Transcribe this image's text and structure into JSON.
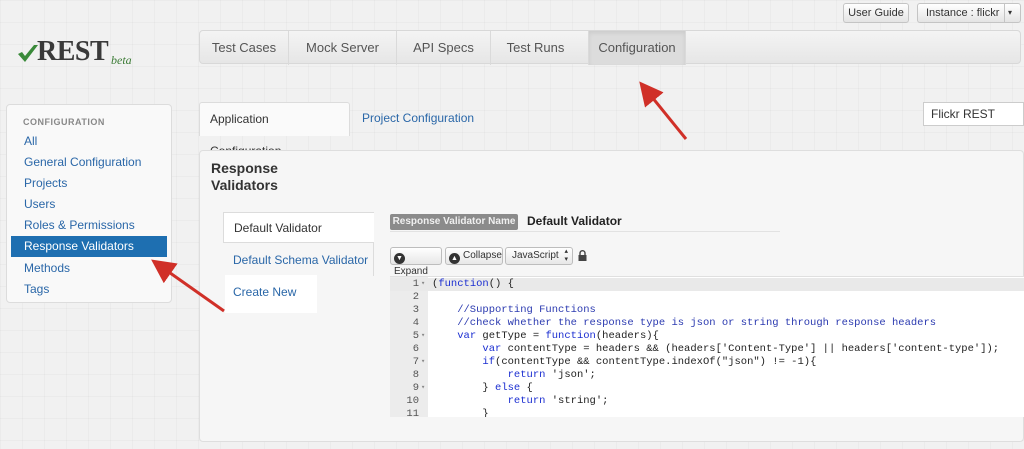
{
  "header": {
    "user_guide": "User Guide",
    "instance": "Instance : flickr"
  },
  "logo": {
    "name": "REST",
    "beta": "beta"
  },
  "mainnav": {
    "tabs": [
      {
        "label": "Test Cases"
      },
      {
        "label": "Mock Server"
      },
      {
        "label": "API Specs"
      },
      {
        "label": "Test Runs"
      },
      {
        "label": "Configuration"
      }
    ]
  },
  "sidebar": {
    "header": "CONFIGURATION",
    "items": [
      {
        "label": "All"
      },
      {
        "label": "General Configuration"
      },
      {
        "label": "Projects"
      },
      {
        "label": "Users"
      },
      {
        "label": "Roles & Permissions"
      },
      {
        "label": "Response Validators"
      },
      {
        "label": "Methods"
      },
      {
        "label": "Tags"
      }
    ]
  },
  "subtabs": {
    "application": "Application Configuration",
    "project": "Project Configuration",
    "project_select": "Flickr REST"
  },
  "panel": {
    "title": "Response Validators",
    "vtabs": {
      "default": "Default Validator",
      "schema": "Default Schema Validator",
      "create": "Create New"
    },
    "name_label": "Response Validator Name",
    "name_value": "Default Validator",
    "toolbar": {
      "expand": "Expand",
      "collapse": "Collapse",
      "language": "JavaScript"
    }
  },
  "editor": {
    "lines": [
      {
        "n": "1",
        "code": "(function() {"
      },
      {
        "n": "2",
        "code": ""
      },
      {
        "n": "3",
        "code": "    //Supporting Functions"
      },
      {
        "n": "4",
        "code": "    //check whether the response type is json or string through response headers"
      },
      {
        "n": "5",
        "code": "    var getType = function(headers){"
      },
      {
        "n": "6",
        "code": "        var contentType = headers && (headers['Content-Type'] || headers['content-type']);"
      },
      {
        "n": "7",
        "code": "        if(contentType && contentType.indexOf(\"json\") != -1){"
      },
      {
        "n": "8",
        "code": "            return 'json';"
      },
      {
        "n": "9",
        "code": "        } else {"
      },
      {
        "n": "10",
        "code": "            return 'string';"
      },
      {
        "n": "11",
        "code": "        }"
      }
    ]
  },
  "colors": {
    "link": "#2a67a8",
    "active_sidebar": "#1e6fb1",
    "arrow": "#d03028",
    "logo_check": "#3a8a3a"
  }
}
